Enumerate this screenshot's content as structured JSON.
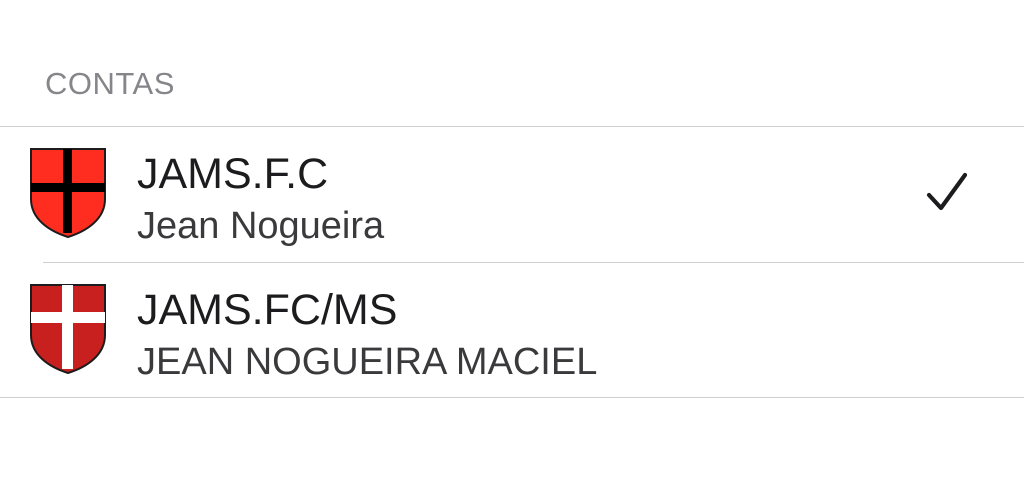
{
  "section": {
    "title": "CONTAS"
  },
  "accounts": [
    {
      "name": "JAMS.F.C",
      "user": "Jean Nogueira",
      "selected": true,
      "icon": "red-shield-black-cross-icon",
      "shield_color": "#ff2d20",
      "cross_color": "#000000"
    },
    {
      "name": "JAMS.FC/MS",
      "user": "JEAN NOGUEIRA MACIEL",
      "selected": false,
      "icon": "red-shield-white-cross-icon",
      "shield_color": "#c8201e",
      "cross_color": "#ffffff"
    }
  ],
  "check_icon": "checkmark-icon"
}
